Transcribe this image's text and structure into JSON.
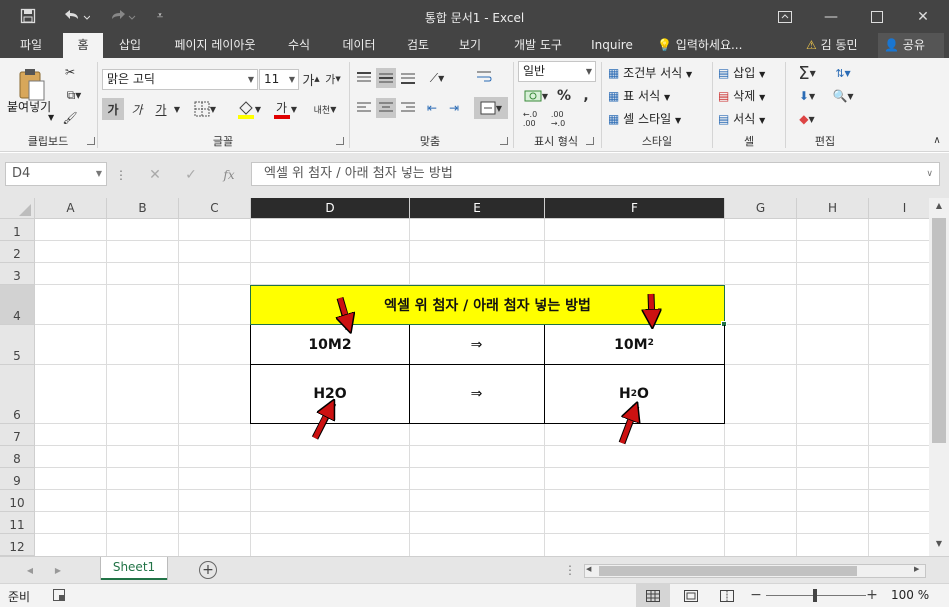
{
  "title_bar": {
    "title": "통합 문서1 - Excel",
    "quick_access": [
      "save-icon",
      "undo-icon",
      "redo-icon",
      "customize-icon"
    ]
  },
  "tabs": [
    "파일",
    "홈",
    "삽입",
    "페이지 레이아웃",
    "수식",
    "데이터",
    "검토",
    "보기",
    "개발 도구",
    "Inquire"
  ],
  "active_tab": "홈",
  "tell_me": "입력하세요...",
  "user": "김 동민",
  "share": "공유",
  "ribbon": {
    "clipboard": {
      "paste": "붙여넣기",
      "group": "클립보드"
    },
    "font": {
      "name": "맑은 고딕",
      "size": "11",
      "bold": "가",
      "italic": "가",
      "underline": "가",
      "group": "글꼴",
      "wrap_icon": "내천"
    },
    "alignment": {
      "group": "맞춤"
    },
    "number": {
      "format": "일반",
      "group": "표시 형식"
    },
    "styles": {
      "conditional": "조건부 서식",
      "table": "표 서식",
      "cell_styles": "셀 스타일",
      "group": "스타일"
    },
    "cells": {
      "insert": "삽입",
      "delete": "삭제",
      "format": "서식",
      "group": "셀"
    },
    "editing": {
      "group": "편집"
    }
  },
  "formula_bar": {
    "name_box": "D4",
    "fx": "fx",
    "content": "엑셀 위 첨자 / 아래 첨자 넣는 방법"
  },
  "columns": [
    "A",
    "B",
    "C",
    "D",
    "E",
    "F",
    "G",
    "H",
    "I"
  ],
  "rows": [
    "1",
    "2",
    "3",
    "4",
    "5",
    "6",
    "7",
    "8",
    "9",
    "10",
    "11",
    "12"
  ],
  "cells": {
    "d4_title": "엑셀 위 첨자 / 아래 첨자 넣는 방법",
    "d5": "10M2",
    "e5": "⇒",
    "f5_base": "10M",
    "f5_sup": "2",
    "d6": "H2O",
    "e6": "⇒",
    "f6_pre": "H",
    "f6_sub": "2",
    "f6_post": "O"
  },
  "colors": {
    "title_fill": "#ffff00",
    "arrow": "#cc1111",
    "accent": "#217346"
  },
  "sheet_tabs": [
    "Sheet1"
  ],
  "status": {
    "ready": "준비",
    "zoom": "100 %"
  }
}
